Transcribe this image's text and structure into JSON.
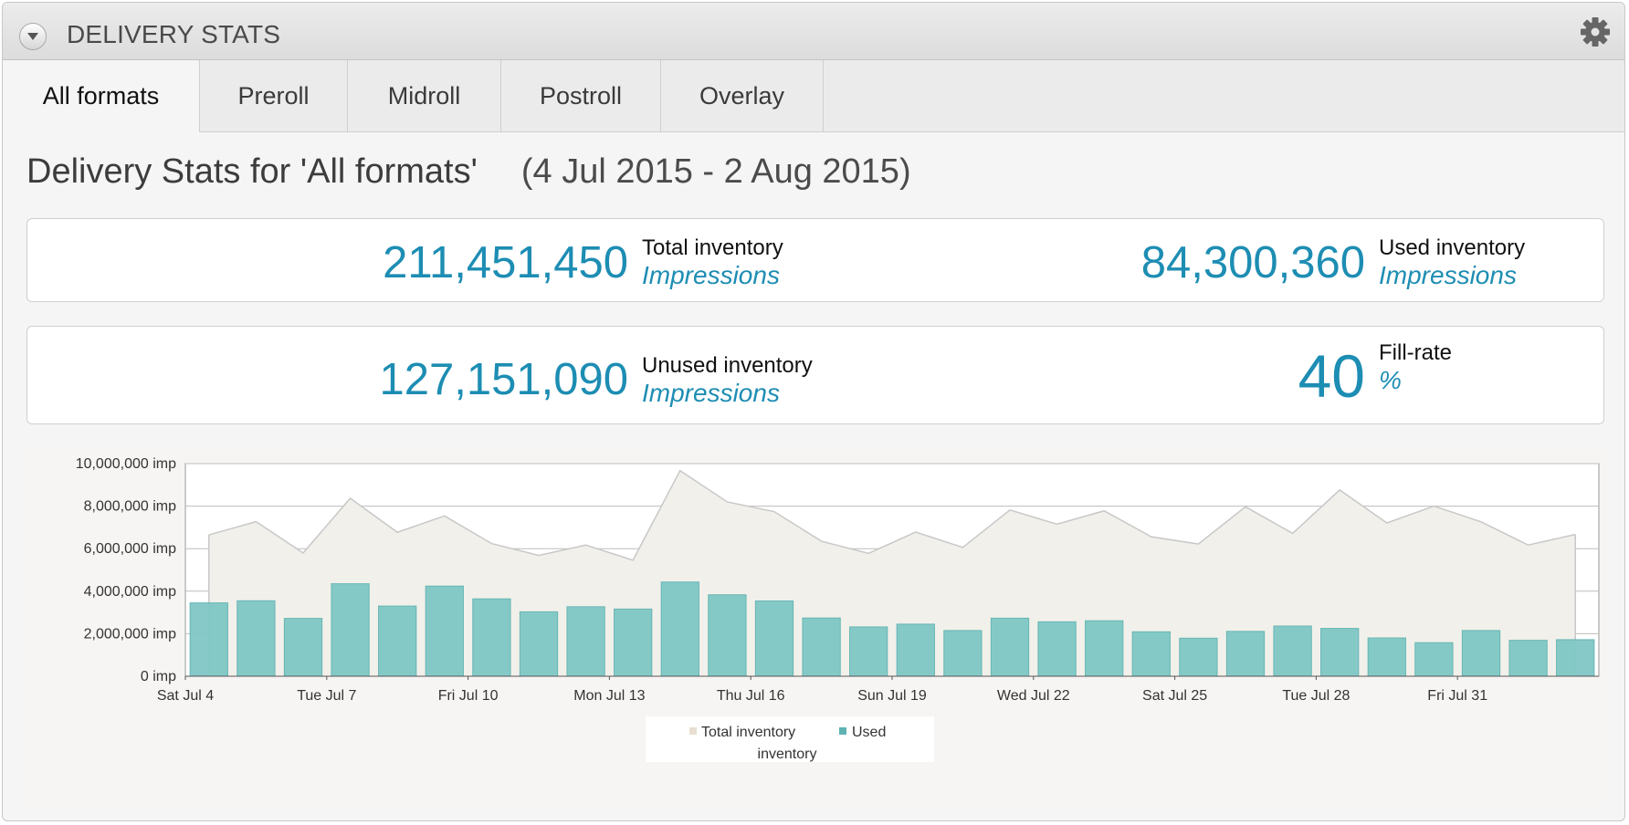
{
  "panel": {
    "title": "DELIVERY STATS",
    "collapse_icon": "chevron-down-icon",
    "settings_icon": "gear-icon"
  },
  "tabs": [
    {
      "label": "All formats",
      "active": true
    },
    {
      "label": "Preroll",
      "active": false
    },
    {
      "label": "Midroll",
      "active": false
    },
    {
      "label": "Postroll",
      "active": false
    },
    {
      "label": "Overlay",
      "active": false
    }
  ],
  "heading": {
    "title": "Delivery Stats for 'All formats'",
    "date_range": "(4 Jul 2015 - 2 Aug 2015)"
  },
  "stats": {
    "total": {
      "value": "211,451,450",
      "label": "Total inventory",
      "unit": "Impressions"
    },
    "used": {
      "value": "84,300,360",
      "label": "Used inventory",
      "unit": "Impressions"
    },
    "unused": {
      "value": "127,151,090",
      "label": "Unused inventory",
      "unit": "Impressions"
    },
    "fill": {
      "value": "40",
      "label": "Fill-rate",
      "unit": "%"
    }
  },
  "colors": {
    "accent": "#1d8db3",
    "bar_fill": "#80c7c6",
    "bar_stroke": "#5fb3b2",
    "area_fill": "#f2f0ea",
    "line": "#c8c8c8"
  },
  "chart_data": {
    "type": "bar",
    "ylim": [
      0,
      10000000
    ],
    "y_ticks": [
      "0 imp",
      "2,000,000 imp",
      "4,000,000 imp",
      "6,000,000 imp",
      "8,000,000 imp",
      "10,000,000 imp"
    ],
    "x_ticks": [
      "Sat Jul 4",
      "Tue Jul 7",
      "Fri Jul 10",
      "Mon Jul 13",
      "Thu Jul 16",
      "Sun Jul 19",
      "Wed Jul 22",
      "Sat Jul 25",
      "Tue Jul 28",
      "Fri Jul 31"
    ],
    "categories": [
      "Jul 4",
      "Jul 5",
      "Jul 6",
      "Jul 7",
      "Jul 8",
      "Jul 9",
      "Jul 10",
      "Jul 11",
      "Jul 12",
      "Jul 13",
      "Jul 14",
      "Jul 15",
      "Jul 16",
      "Jul 17",
      "Jul 18",
      "Jul 19",
      "Jul 20",
      "Jul 21",
      "Jul 22",
      "Jul 23",
      "Jul 24",
      "Jul 25",
      "Jul 26",
      "Jul 27",
      "Jul 28",
      "Jul 29",
      "Jul 30",
      "Jul 31",
      "Aug 1",
      "Aug 2"
    ],
    "series": [
      {
        "name": "Total inventory",
        "type": "area",
        "values": [
          6650000,
          7270000,
          5800000,
          8370000,
          6770000,
          7540000,
          6240000,
          5680000,
          6170000,
          5460000,
          9670000,
          8200000,
          7740000,
          6350000,
          5780000,
          6780000,
          6060000,
          7820000,
          7150000,
          7780000,
          6560000,
          6220000,
          7970000,
          6720000,
          8760000,
          7210000,
          8000000,
          7260000,
          6170000,
          6670000
        ]
      },
      {
        "name": "Used inventory",
        "type": "bar",
        "values": [
          3450000,
          3550000,
          2720000,
          4350000,
          3300000,
          4240000,
          3640000,
          3030000,
          3270000,
          3160000,
          4430000,
          3830000,
          3540000,
          2740000,
          2320000,
          2450000,
          2150000,
          2730000,
          2560000,
          2610000,
          2090000,
          1790000,
          2110000,
          2360000,
          2250000,
          1800000,
          1580000,
          2150000,
          1690000,
          1720000
        ]
      }
    ],
    "legend": {
      "position": "bottom",
      "items": [
        "Total inventory",
        "Used inventory"
      ]
    }
  }
}
